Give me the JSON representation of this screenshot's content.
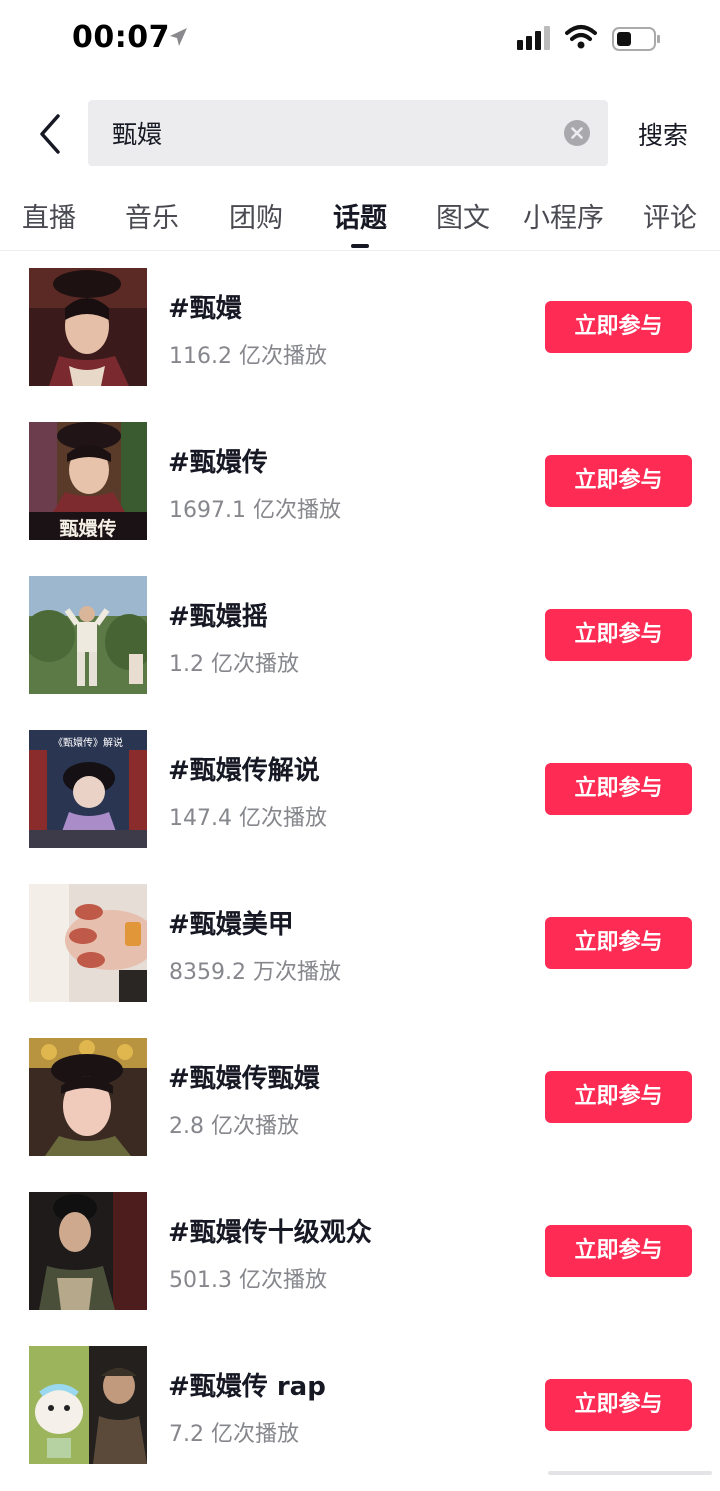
{
  "status_bar": {
    "time": "00:07"
  },
  "search": {
    "query": "甄嬛",
    "button_label": "搜索"
  },
  "tabs": [
    {
      "label": "直播"
    },
    {
      "label": "音乐"
    },
    {
      "label": "团购"
    },
    {
      "label": "话题",
      "active": true
    },
    {
      "label": "图文"
    },
    {
      "label": "小程序"
    },
    {
      "label": "评论"
    }
  ],
  "topics": [
    {
      "name": "#甄嬛",
      "plays": "116.2 亿次播放",
      "action": "立即参与"
    },
    {
      "name": "#甄嬛传",
      "plays": "1697.1 亿次播放",
      "action": "立即参与",
      "thumb_caption": "甄嬛传"
    },
    {
      "name": "#甄嬛摇",
      "plays": "1.2 亿次播放",
      "action": "立即参与"
    },
    {
      "name": "#甄嬛传解说",
      "plays": "147.4 亿次播放",
      "action": "立即参与",
      "thumb_caption": "《甄嬛传》解说"
    },
    {
      "name": "#甄嬛美甲",
      "plays": "8359.2 万次播放",
      "action": "立即参与"
    },
    {
      "name": "#甄嬛传甄嬛",
      "plays": "2.8 亿次播放",
      "action": "立即参与"
    },
    {
      "name": "#甄嬛传十级观众",
      "plays": "501.3 亿次播放",
      "action": "立即参与"
    },
    {
      "name": "#甄嬛传 rap",
      "plays": "7.2 亿次播放",
      "action": "立即参与"
    }
  ],
  "colors": {
    "accent": "#fe2c55",
    "text_primary": "#161823",
    "text_secondary": "#86878c",
    "search_bg": "#ececee"
  },
  "icons": [
    "location-arrow-icon",
    "signal-icon",
    "wifi-icon",
    "battery-icon",
    "back-arrow-icon",
    "clear-icon"
  ]
}
